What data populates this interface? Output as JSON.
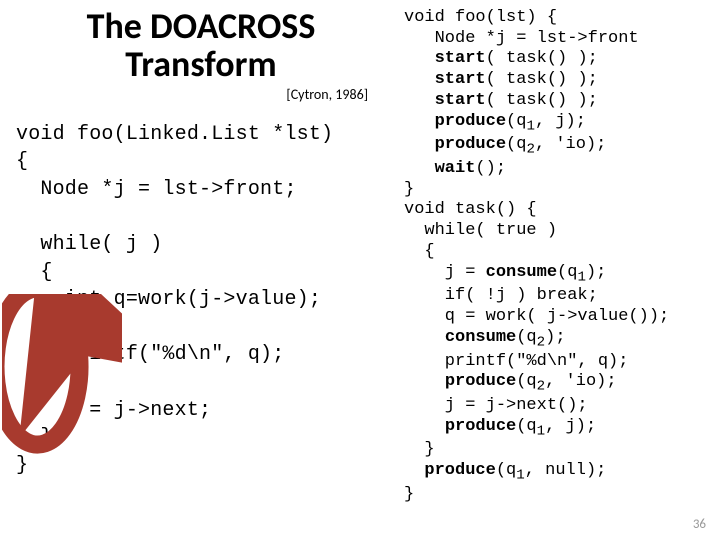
{
  "title_line1": "The DOACROSS",
  "title_line2": "Transform",
  "citation": "[Cytron, 1986]",
  "left_code": "void foo(Linked.List *lst)\n{\n  Node *j = lst->front;\n\n  while( j )\n  {\n    int q=work(j->value);\n\n    printf(\"%d\\n\", q);\n\n    j = j->next;\n  }\n}",
  "right_code_html": "void foo(lst) {\n   Node *j = lst->front\n   <b>start</b>( task() );\n   <b>start</b>( task() );\n   <b>start</b>( task() );\n   <b>produce</b>(q<sub>1</sub>, j);\n   <b>produce</b>(q<sub>2</sub>, 'io);\n   <b>wait</b>();\n}\nvoid task() {\n  while( true )\n  {\n    j = <b>consume</b>(q<sub>1</sub>);\n    if( !j ) break;\n    q = work( j->value());\n    <b>consume</b>(q<sub>2</sub>);\n    printf(\"%d\\n\", q);\n    <b>produce</b>(q<sub>2</sub>, 'io);\n    j = j->next();\n    <b>produce</b>(q<sub>1</sub>, j);\n  }\n  <b>produce</b>(q<sub>1</sub>, null);\n}",
  "page_number": "36",
  "arrow_color": "#a83a2e"
}
